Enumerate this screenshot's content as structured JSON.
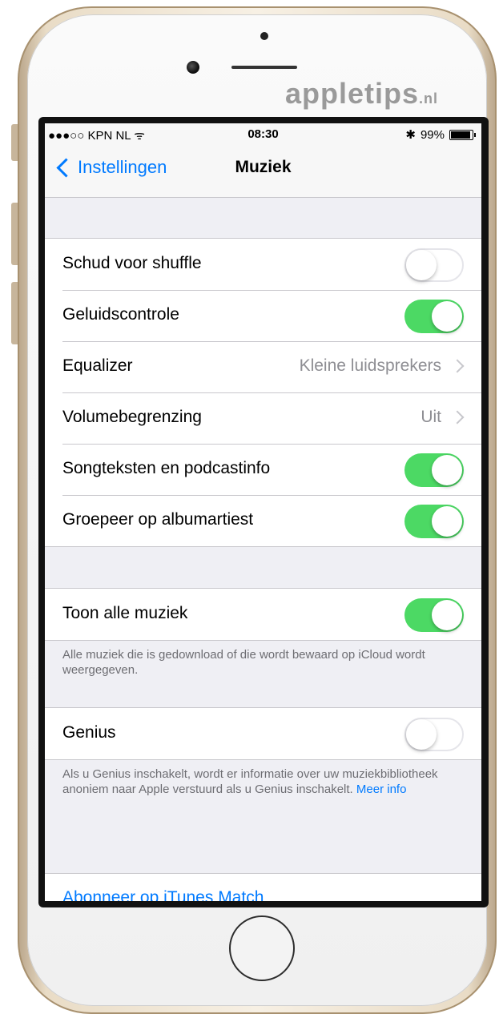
{
  "watermark": {
    "main": "appletips",
    "suffix": ".nl"
  },
  "statusbar": {
    "carrier": "●●●○○ KPN NL",
    "wifi_glyph": "ᯤ",
    "time": "08:30",
    "bluetooth_glyph": "✱",
    "battery": "99%"
  },
  "navbar": {
    "back_label": "Instellingen",
    "title": "Muziek"
  },
  "group1": [
    {
      "label": "Schud voor shuffle",
      "type": "switch",
      "on": false
    },
    {
      "label": "Geluidscontrole",
      "type": "switch",
      "on": true
    },
    {
      "label": "Equalizer",
      "type": "disclosure",
      "value": "Kleine luidsprekers"
    },
    {
      "label": "Volumebegrenzing",
      "type": "disclosure",
      "value": "Uit"
    },
    {
      "label": "Songteksten en podcastinfo",
      "type": "switch",
      "on": true
    },
    {
      "label": "Groepeer op albumartiest",
      "type": "switch",
      "on": true
    }
  ],
  "group2": {
    "label": "Toon alle muziek",
    "on": true
  },
  "note2": "Alle muziek die is gedownload of die wordt bewaard op iCloud wordt weergegeven.",
  "group3": {
    "label": "Genius",
    "on": false
  },
  "note3": {
    "text": "Als u Genius inschakelt, wordt er informatie over uw muziekbibliotheek anoniem naar Apple verstuurd als u Genius inschakelt.",
    "link": "Meer info"
  },
  "itunes_match": "Abonneer op iTunes Match",
  "colors": {
    "accent": "#007aff",
    "switch_on": "#4cd964",
    "background": "#efeff4"
  }
}
